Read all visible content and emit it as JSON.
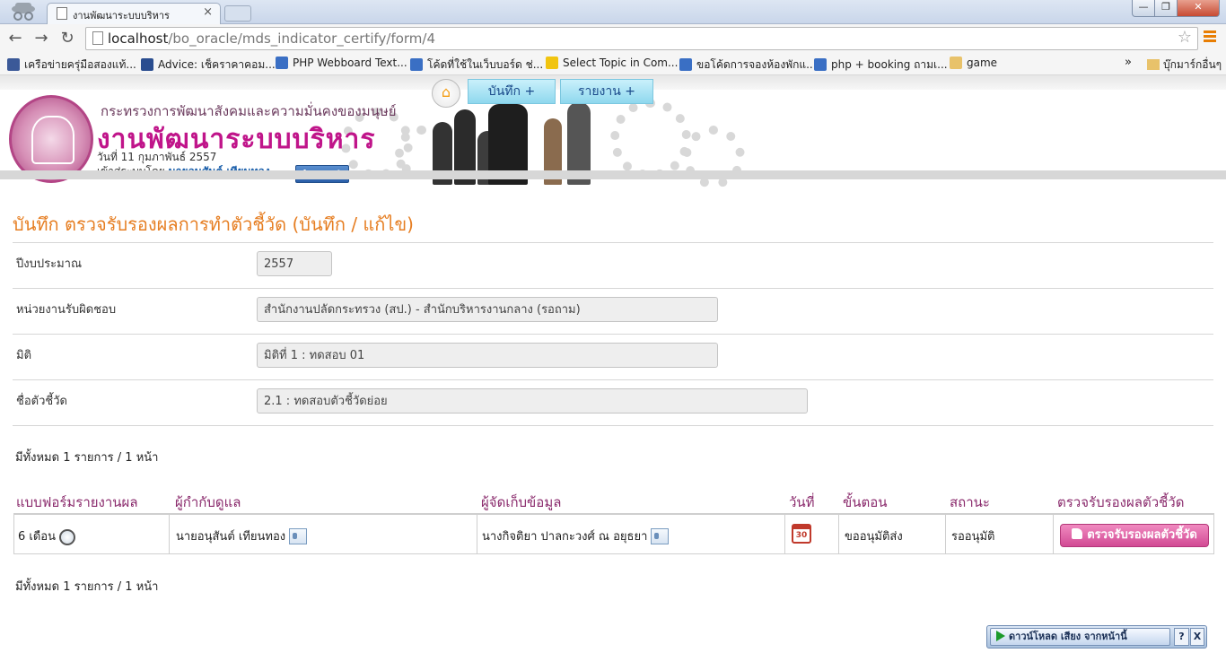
{
  "browser": {
    "tab_title": "งานพัฒนาระบบบริหาร",
    "tab_close": "×",
    "window_min": "—",
    "window_max": "❐",
    "window_close": "✕",
    "back": "←",
    "forward": "→",
    "reload": "↻",
    "url_host": "localhost",
    "url_path": "/bo_oracle/mds_indicator_certify/form/4",
    "star": "☆",
    "bookmarks": [
      {
        "label": "เครือข่ายครุ่มือสองแท้...",
        "color": "#3b5998"
      },
      {
        "label": "Advice: เช็คราคาคอม...",
        "color": "#2a4d8f"
      },
      {
        "label": "PHP Webboard Text...",
        "color": "#3a6fc4"
      },
      {
        "label": "โค้ดที่ใช้ในเว็บบอร์ด ช่...",
        "color": "#3a6fc4"
      },
      {
        "label": "Select Topic in Com...",
        "color": "#f1c40f"
      },
      {
        "label": "ขอโค้ดการจองห้องพักแ...",
        "color": "#3a6fc4"
      },
      {
        "label": "php + booking ถามเ...",
        "color": "#3a6fc4"
      },
      {
        "label": "game",
        "color": "#e8c26a"
      }
    ],
    "more": "»",
    "other_bookmarks": "บุ๊กมาร์กอื่นๆ"
  },
  "header": {
    "org_name": "กระทรวงการพัฒนาสังคมและความมั่นคงของมนุษย์",
    "app_title": "งานพัฒนาระบบบริหาร",
    "date": "วันที่ 11 กุมภาพันธ์ 2557",
    "login_prefix": "เข้าสู่ระบบโดย",
    "username": "นายอนุสันต์ เทียนทอง",
    "logout": "Logout",
    "home_icon": "⌂",
    "menu": [
      "บันทึก +",
      "รายงาน +"
    ]
  },
  "page_title": "บันทึก ตรวจรับรองผลการทำตัวชี้วัด (บันทึก / แก้ไข)",
  "form": {
    "fields": [
      {
        "label": "ปีงบประมาณ",
        "value": "2557"
      },
      {
        "label": "หน่วยงานรับผิดชอบ",
        "value": "สำนักงานปลัดกระทรวง (สป.) - สำนักบริหารงานกลาง (รอถาม)"
      },
      {
        "label": "มิติ",
        "value": "มิติที่ 1 : ทดสอบ 01"
      },
      {
        "label": "ชื่อตัวชี้วัด",
        "value": "2.1 : ทดสอบตัวชี้วัดย่อย"
      }
    ]
  },
  "summary_top": "มีทั้งหมด 1 รายการ / 1 หน้า",
  "table": {
    "headers": [
      "แบบฟอร์มรายงานผล",
      "ผู้กำกับดูแล",
      "ผู้จัดเก็บข้อมูล",
      "วันที่",
      "ขั้นตอน",
      "สถานะ",
      "ตรวจรับรองผลตัวชี้วัด"
    ],
    "rows": [
      {
        "form": "6 เดือน",
        "supervisor": "นายอนุสันต์ เทียนทอง",
        "collector": "นางกิจติยา ปาลกะวงศ์ ณ อยุธยา",
        "date_icon_text": "30",
        "step": "ขออนุมัติส่ง",
        "status": "รออนุมัติ",
        "action": "ตรวจรับรองผลตัวชี้วัด"
      }
    ]
  },
  "summary_bottom": "มีทั้งหมด 1 รายการ / 1 หน้า",
  "download_bar": {
    "label": "ดาวน์โหลด เสียง จากหน้านี้",
    "help": "?",
    "close": "X"
  }
}
